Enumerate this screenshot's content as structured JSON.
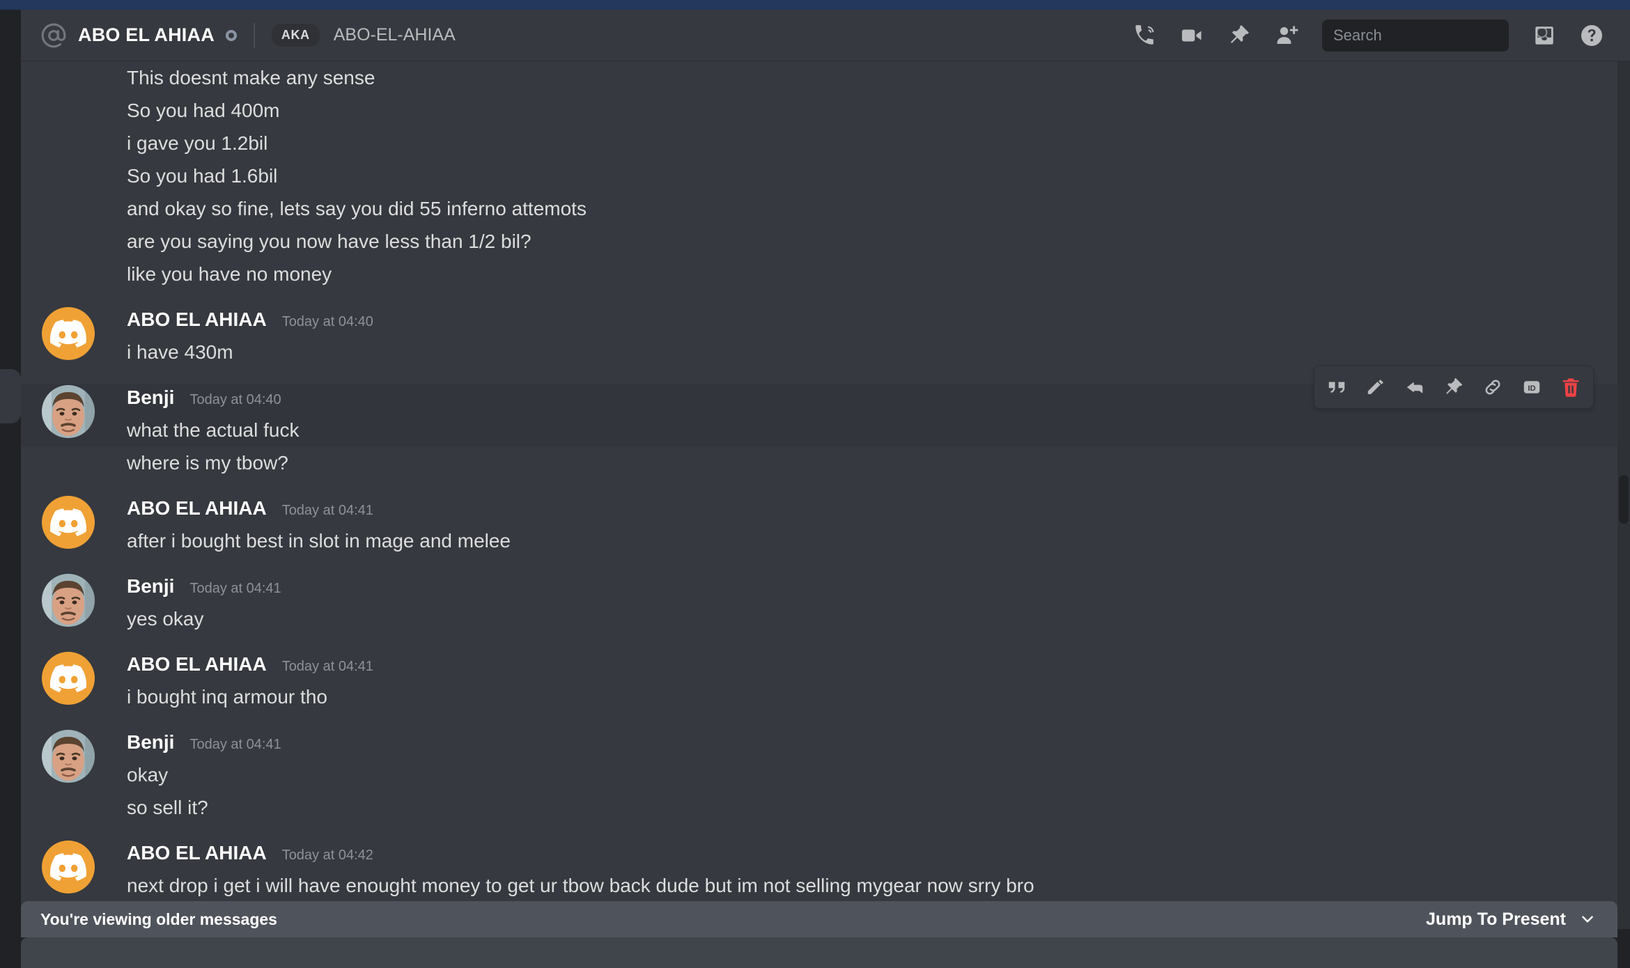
{
  "window": {
    "accent_color": "#24375c"
  },
  "header": {
    "at_icon": "at-sign-icon",
    "title": "ABO EL AHIAA",
    "status": "offline",
    "aka_badge": "AKA",
    "aka_name": "ABO-EL-AHIAA",
    "icons": [
      {
        "name": "start-voice-call-icon",
        "label": "Start Voice Call"
      },
      {
        "name": "start-video-call-icon",
        "label": "Start Video Call"
      },
      {
        "name": "pinned-messages-icon",
        "label": "Pinned Messages"
      },
      {
        "name": "add-friends-icon",
        "label": "Add Friends to DM"
      },
      {
        "name": "inbox-icon",
        "label": "Inbox"
      },
      {
        "name": "help-icon",
        "label": "Help"
      }
    ],
    "search": {
      "placeholder": "Search",
      "value": "",
      "icon": "search-icon"
    }
  },
  "conversation": {
    "leading_lines": [
      "This doesnt make any sense",
      "So you had 400m",
      "i gave you 1.2bil",
      "So you had 1.6bil",
      "and okay so fine, lets say you did 55 inferno attemots",
      "are you saying you now have less than 1/2 bil?",
      "like you have no money"
    ],
    "groups": [
      {
        "author": "ABO EL AHIAA",
        "avatar": "discord-logo-avatar",
        "avatar_color": "#f0a135",
        "timestamp": "Today at 04:40",
        "lines": [
          "i have 430m"
        ],
        "hovered": false
      },
      {
        "author": "Benji",
        "avatar": "photo-avatar",
        "avatar_color": "#8aa0a8",
        "timestamp": "Today at 04:40",
        "lines": [
          "what the actual fuck",
          "where is my tbow?"
        ],
        "hovered": true
      },
      {
        "author": "ABO EL AHIAA",
        "avatar": "discord-logo-avatar",
        "avatar_color": "#f0a135",
        "timestamp": "Today at 04:41",
        "lines": [
          "after i bought best in slot in mage and melee"
        ],
        "hovered": false
      },
      {
        "author": "Benji",
        "avatar": "photo-avatar",
        "avatar_color": "#8aa0a8",
        "timestamp": "Today at 04:41",
        "lines": [
          "yes okay"
        ],
        "hovered": false
      },
      {
        "author": "ABO EL AHIAA",
        "avatar": "discord-logo-avatar",
        "avatar_color": "#f0a135",
        "timestamp": "Today at 04:41",
        "lines": [
          "i bought inq armour tho"
        ],
        "hovered": false
      },
      {
        "author": "Benji",
        "avatar": "photo-avatar",
        "avatar_color": "#8aa0a8",
        "timestamp": "Today at 04:41",
        "lines": [
          "okay",
          "so sell it?"
        ],
        "hovered": false
      },
      {
        "author": "ABO EL AHIAA",
        "avatar": "discord-logo-avatar",
        "avatar_color": "#f0a135",
        "timestamp": "Today at 04:42",
        "lines": [
          "next drop i get i will have enought money to get ur tbow back dude but im not selling mygear now srry bro"
        ],
        "hovered": false
      }
    ]
  },
  "hover_toolbar": {
    "buttons": [
      {
        "name": "quote-icon",
        "label": "Quote"
      },
      {
        "name": "edit-pencil-icon",
        "label": "Edit"
      },
      {
        "name": "reply-icon",
        "label": "Reply"
      },
      {
        "name": "pin-icon",
        "label": "Pin"
      },
      {
        "name": "copy-link-icon",
        "label": "Copy Link"
      },
      {
        "name": "copy-id-icon",
        "label": "ID"
      },
      {
        "name": "delete-icon",
        "label": "Delete",
        "color": "#ed4245"
      }
    ]
  },
  "older_bar": {
    "message": "You're viewing older messages",
    "jump_label": "Jump To Present",
    "chevron": "chevron-down-icon"
  }
}
